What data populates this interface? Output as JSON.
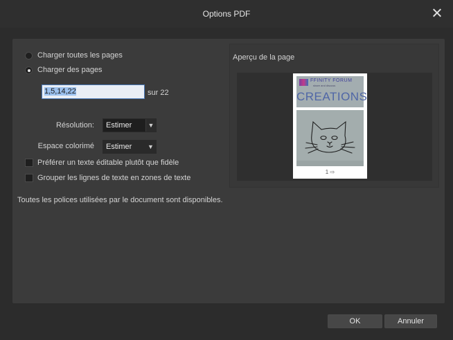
{
  "window": {
    "title": "Options PDF"
  },
  "load": {
    "all_pages_label": "Charger toutes les pages",
    "some_pages_label": "Charger des pages",
    "pages_value": "1,5,14,22",
    "page_count_label": "sur 22"
  },
  "options": {
    "resolution_label": "Résolution:",
    "resolution_value": "Estimer",
    "colorspace_label": "Espace colorimé",
    "colorspace_value": "Estimer",
    "editable_text_label": "Préférer un texte éditable plutôt que fidèle",
    "group_lines_label": "Grouper les lignes de texte en zones de texte"
  },
  "preview": {
    "title": "Aperçu de la page",
    "thumb_header": "FFINITY FORUM",
    "thumb_header_sub": "share and discuss",
    "thumb_title": "CREATIONS",
    "page_indicator": "1"
  },
  "status": {
    "message": "Toutes les polices utilisées par le document sont disponibles."
  },
  "buttons": {
    "ok": "OK",
    "cancel": "Annuler"
  }
}
